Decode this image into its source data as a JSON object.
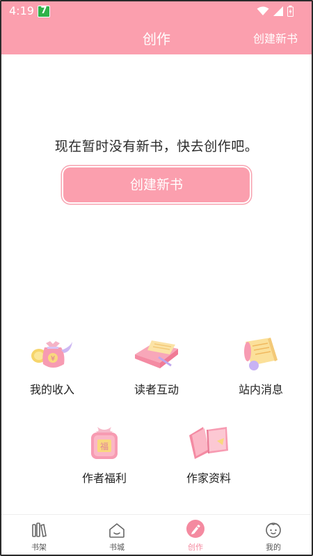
{
  "status": {
    "time": "4:19",
    "app_badge": "7"
  },
  "header": {
    "title": "创作",
    "action": "创建新书"
  },
  "empty": {
    "message": "现在暂时没有新书，快去创作吧。",
    "button": "创建新书"
  },
  "features": [
    {
      "label": "我的收入",
      "icon": "money-bag-icon"
    },
    {
      "label": "读者互动",
      "icon": "letter-icon"
    },
    {
      "label": "站内消息",
      "icon": "scroll-icon"
    },
    {
      "label": "作者福利",
      "icon": "gift-box-icon"
    },
    {
      "label": "作家资料",
      "icon": "book-icon"
    }
  ],
  "tabs": [
    {
      "label": "书架",
      "icon": "bookshelf-icon"
    },
    {
      "label": "书城",
      "icon": "home-icon"
    },
    {
      "label": "创作",
      "icon": "pen-icon",
      "active": true
    },
    {
      "label": "我的",
      "icon": "profile-face-icon"
    }
  ],
  "colors": {
    "primary": "#fb9fae",
    "active_tab": "#f48aa0"
  }
}
